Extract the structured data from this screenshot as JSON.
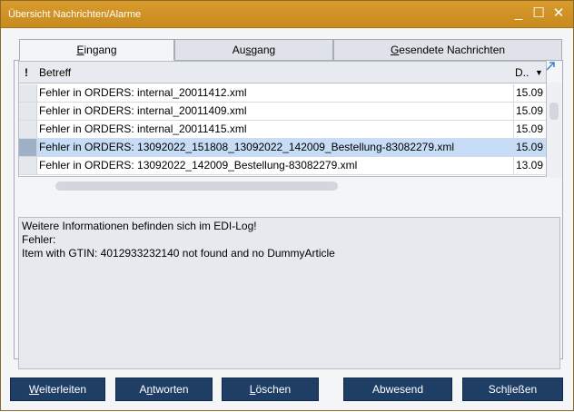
{
  "window": {
    "title": "Übersicht Nachrichten/Alarme"
  },
  "window_controls": {
    "minimize": "_",
    "maximize": "☐",
    "close": "✕"
  },
  "tabs": [
    {
      "pre": "",
      "ul": "E",
      "post": "ingang"
    },
    {
      "pre": "Au",
      "ul": "s",
      "post": "gang"
    },
    {
      "pre": "",
      "ul": "G",
      "post": "esendete Nachrichten"
    }
  ],
  "grid": {
    "headers": {
      "flag": "!",
      "subject": "Betreff",
      "date": "D.."
    },
    "rows": [
      {
        "subject": "Fehler in ORDERS: internal_20011412.xml",
        "date": "15.09",
        "selected": false
      },
      {
        "subject": "Fehler in ORDERS: internal_20011409.xml",
        "date": "15.09",
        "selected": false
      },
      {
        "subject": "Fehler in ORDERS: internal_20011415.xml",
        "date": "15.09",
        "selected": false
      },
      {
        "subject": "Fehler in ORDERS: 13092022_151808_13092022_142009_Bestellung-83082279.xml",
        "date": "15.09",
        "selected": true
      },
      {
        "subject": "Fehler in ORDERS: 13092022_142009_Bestellung-83082279.xml",
        "date": "13.09",
        "selected": false
      }
    ]
  },
  "details": {
    "lines": [
      "Weitere Informationen befinden sich im EDI-Log!",
      "Fehler:",
      "Item with GTIN: 4012933232140 not found and no DummyArticle"
    ]
  },
  "buttons": [
    {
      "pre": "",
      "ul": "W",
      "post": "eiterleiten"
    },
    {
      "pre": "A",
      "ul": "n",
      "post": "tworten"
    },
    {
      "pre": "",
      "ul": "L",
      "post": "öschen"
    },
    {
      "pre": "Abwesend",
      "ul": "",
      "post": ""
    },
    {
      "pre": "Sch",
      "ul": "l",
      "post": "ießen"
    }
  ]
}
